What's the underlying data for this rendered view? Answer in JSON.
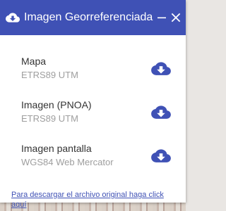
{
  "header": {
    "title": "Imagen Georreferenciada",
    "background_color": "#3f51b5",
    "icons": {
      "download": "cloud-download-icon",
      "minimize": "minimize-icon",
      "close": "close-icon"
    }
  },
  "items": [
    {
      "name": "Mapa",
      "sub": "ETRS89 UTM"
    },
    {
      "name": "Imagen (PNOA)",
      "sub": "ETRS89 UTM"
    },
    {
      "name": "Imagen pantalla",
      "sub": "WGS84 Web Mercator"
    }
  ],
  "download_icon_color": "#3f51b5",
  "footer_link": "Para descargar el archivo original haga click aquí"
}
